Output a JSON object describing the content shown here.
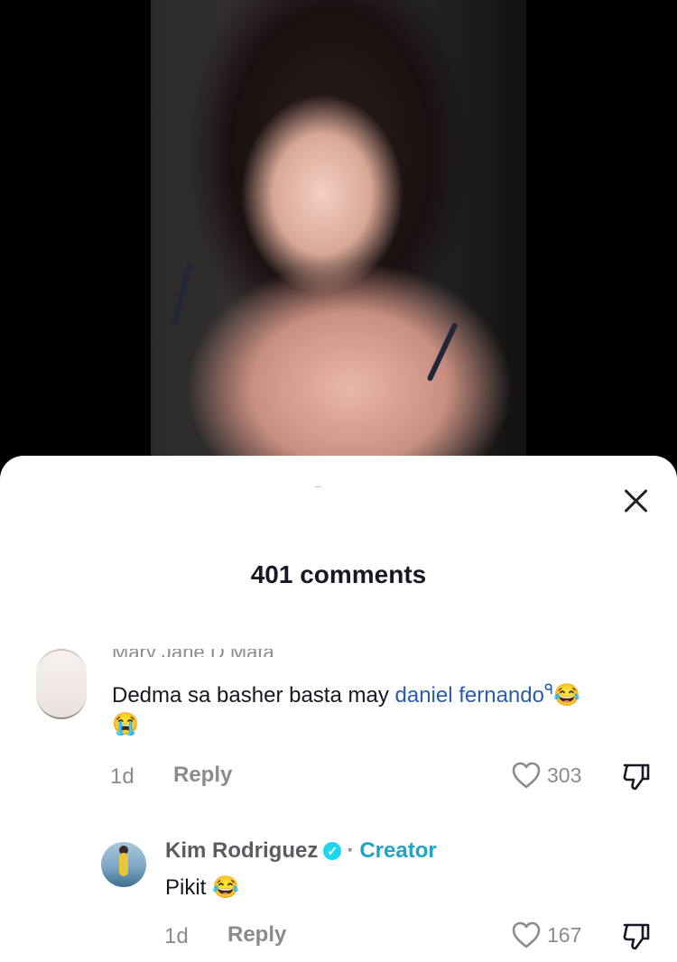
{
  "panel": {
    "title": "401 comments"
  },
  "comments": [
    {
      "author_cut": "Mary Jane D Mata",
      "text_before": "Dedma sa basher basta may ",
      "mention": "daniel fernando",
      "search_glyph": "ᑫ",
      "emoji_inline": "😂",
      "emoji_next_line": "😭",
      "time": "1d",
      "reply_label": "Reply",
      "likes": "303"
    },
    {
      "author": "Kim Rodriguez",
      "verified_glyph": "✓",
      "separator": "·",
      "creator_label": "Creator",
      "text": "Pikit ",
      "emoji": "😂",
      "time": "1d",
      "reply_label": "Reply",
      "likes": "167"
    }
  ],
  "colors": {
    "accent_mention": "#2a5da8",
    "creator": "#20a3c9",
    "verified": "#20d5ec",
    "muted": "#8a8b91"
  }
}
